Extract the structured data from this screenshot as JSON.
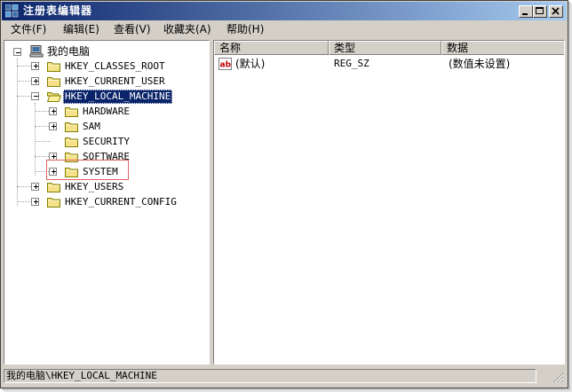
{
  "window": {
    "title": "注册表编辑器",
    "title_icon": "registry-editor-icon",
    "controls": {
      "minimize": "minimize-icon",
      "maximize": "maximize-icon",
      "close": "close-icon"
    }
  },
  "menu": [
    "文件(F)",
    "编辑(E)",
    "查看(V)",
    "收藏夹(A)",
    "帮助(H)"
  ],
  "tree": {
    "root": "我的电脑",
    "hives": {
      "classes_root": "HKEY_CLASSES_ROOT",
      "current_user": "HKEY_CURRENT_USER",
      "local_machine": "HKEY_LOCAL_MACHINE",
      "users": "HKEY_USERS",
      "current_config": "HKEY_CURRENT_CONFIG"
    },
    "local_machine_children": [
      "HARDWARE",
      "SAM",
      "SECURITY",
      "SOFTWARE",
      "SYSTEM"
    ],
    "selected": "HKEY_LOCAL_MACHINE",
    "highlighted": "SYSTEM"
  },
  "list": {
    "columns": [
      "名称",
      "类型",
      "数据"
    ],
    "rows": [
      {
        "name": "(默认)",
        "type": "REG_SZ",
        "data": "(数值未设置)",
        "icon": "string-value-icon"
      }
    ]
  },
  "status": {
    "path": "我的电脑\\HKEY_LOCAL_MACHINE"
  },
  "colors": {
    "titlebar_start": "#0a246a",
    "titlebar_end": "#a6caf0",
    "selection": "#0a246a",
    "face": "#d4d0c8",
    "highlight_box": "#e06060"
  }
}
